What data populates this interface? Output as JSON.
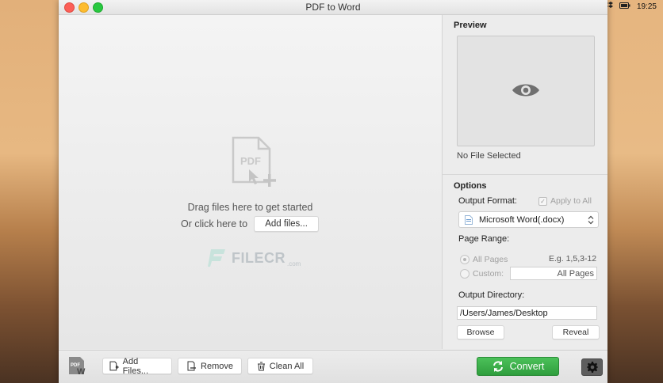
{
  "window": {
    "title": "PDF to Word"
  },
  "menubar": {
    "time": "19:25"
  },
  "dropzone": {
    "drag_text": "Drag files here to get started",
    "or_click_text": "Or click here to",
    "add_files_label": "Add files...",
    "watermark": {
      "brand": "FILECR",
      "suffix": ".com"
    }
  },
  "preview": {
    "title": "Preview",
    "status": "No File Selected"
  },
  "options": {
    "title": "Options",
    "output_format_label": "Output Format:",
    "apply_to_all_label": "Apply to All",
    "format_selected": "Microsoft Word(.docx)",
    "page_range_label": "Page Range:",
    "all_pages_label": "All Pages",
    "example_label": "E.g. 1,5,3-12",
    "custom_label": "Custom:",
    "custom_value": "All Pages",
    "output_dir_label": "Output Directory:",
    "output_dir_value": "/Users/James/Desktop",
    "browse_label": "Browse",
    "reveal_label": "Reveal"
  },
  "toolbar": {
    "add_files_label": "Add Files...",
    "remove_label": "Remove",
    "clean_all_label": "Clean All",
    "convert_label": "Convert"
  },
  "colors": {
    "convert_green": "#3aae49",
    "close": "#fc5f57",
    "minimize": "#fdbc2e",
    "zoom": "#28c840"
  },
  "icons": [
    "pdf-add-icon",
    "eye-icon",
    "document-icon",
    "chevron-updown-icon",
    "add-file-icon",
    "remove-icon",
    "trash-icon",
    "refresh-icon",
    "gear-icon",
    "app-logo-icon"
  ]
}
